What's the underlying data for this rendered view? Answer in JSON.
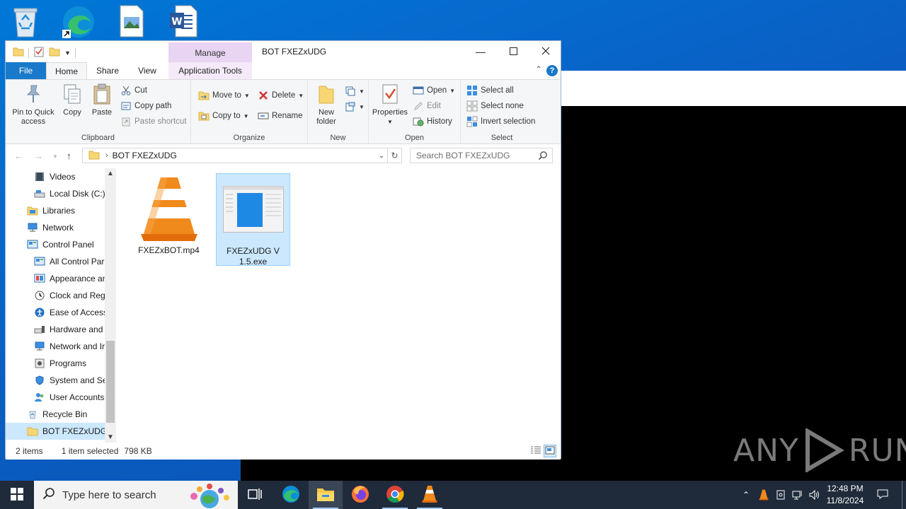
{
  "window": {
    "title": "BOT FXEZxUDG",
    "manage_label": "Manage",
    "tabs": {
      "file": "File",
      "home": "Home",
      "share": "Share",
      "view": "View",
      "app_tools": "Application Tools"
    }
  },
  "ribbon": {
    "clipboard": {
      "label": "Clipboard",
      "pin": "Pin to Quick access",
      "copy": "Copy",
      "paste": "Paste",
      "cut": "Cut",
      "copy_path": "Copy path",
      "paste_shortcut": "Paste shortcut"
    },
    "organize": {
      "label": "Organize",
      "move_to": "Move to",
      "copy_to": "Copy to",
      "delete": "Delete",
      "rename": "Rename"
    },
    "new": {
      "label": "New",
      "new_folder": "New folder"
    },
    "open": {
      "label": "Open",
      "properties": "Properties",
      "open": "Open",
      "edit": "Edit",
      "history": "History"
    },
    "select": {
      "label": "Select",
      "select_all": "Select all",
      "select_none": "Select none",
      "invert": "Invert selection"
    }
  },
  "address": {
    "path": "BOT FXEZxUDG",
    "search_placeholder": "Search BOT FXEZxUDG"
  },
  "nav_items": [
    {
      "label": "Videos",
      "icon": "videos-icon"
    },
    {
      "label": "Local Disk (C:)",
      "icon": "drive-icon"
    },
    {
      "label": "Libraries",
      "icon": "libraries-icon"
    },
    {
      "label": "Network",
      "icon": "network-icon"
    },
    {
      "label": "Control Panel",
      "icon": "control-panel-icon"
    },
    {
      "label": "All Control Par",
      "icon": "control-panel-icon"
    },
    {
      "label": "Appearance an",
      "icon": "appearance-icon"
    },
    {
      "label": "Clock and Regi",
      "icon": "clock-icon"
    },
    {
      "label": "Ease of Access",
      "icon": "ease-of-access-icon"
    },
    {
      "label": "Hardware and",
      "icon": "hardware-icon"
    },
    {
      "label": "Network and Ir",
      "icon": "network-icon"
    },
    {
      "label": "Programs",
      "icon": "programs-icon"
    },
    {
      "label": "System and Sec",
      "icon": "security-icon"
    },
    {
      "label": "User Accounts",
      "icon": "users-icon"
    },
    {
      "label": "Recycle Bin",
      "icon": "recycle-bin-icon"
    },
    {
      "label": "BOT FXEZxUDG",
      "icon": "folder-icon"
    }
  ],
  "files": [
    {
      "name": "FXEZxBOT.mp4",
      "icon": "vlc-cone-icon",
      "selected": false
    },
    {
      "name": "FXEZxUDG V 1.5.exe",
      "icon": "exe-thumbnail-icon",
      "selected": true
    }
  ],
  "status": {
    "count": "2 items",
    "selection": "1 item selected",
    "size": "798 KB"
  },
  "taskbar": {
    "search_placeholder": "Type here to search",
    "time": "12:48 PM",
    "date": "11/8/2024"
  },
  "watermark": {
    "text_left": "ANY",
    "text_right": "RUN"
  },
  "colors": {
    "accent": "#1979ca",
    "selection": "#cce8ff",
    "manage_tab": "#e9d4f3",
    "taskbar": "#1f2a3a"
  }
}
